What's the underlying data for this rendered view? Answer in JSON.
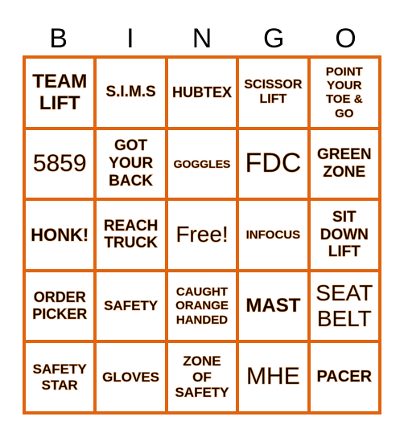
{
  "header": {
    "letters": [
      "B",
      "I",
      "N",
      "G",
      "O"
    ]
  },
  "colors": {
    "border": "#e0640f",
    "text": "#000000"
  },
  "cells": [
    "TEAM\nLIFT",
    "S.I.M.S",
    "HUBTEX",
    "SCISSOR\nLIFT",
    "POINT\nYOUR\nTOE &\nGO",
    "5859",
    "GOT\nYOUR\nBACK",
    "GOGGLES",
    "FDC",
    "GREEN\nZONE",
    "HONK!",
    "REACH\nTRUCK",
    "Free!",
    "INFOCUS",
    "SIT\nDOWN\nLIFT",
    "ORDER\nPICKER",
    "SAFETY",
    "CAUGHT\nORANGE\nHANDED",
    "MAST",
    "SEAT\nBELT",
    "SAFETY\nSTAR",
    "GLOVES",
    "ZONE\nOF\nSAFETY",
    "MHE",
    "PACER"
  ]
}
